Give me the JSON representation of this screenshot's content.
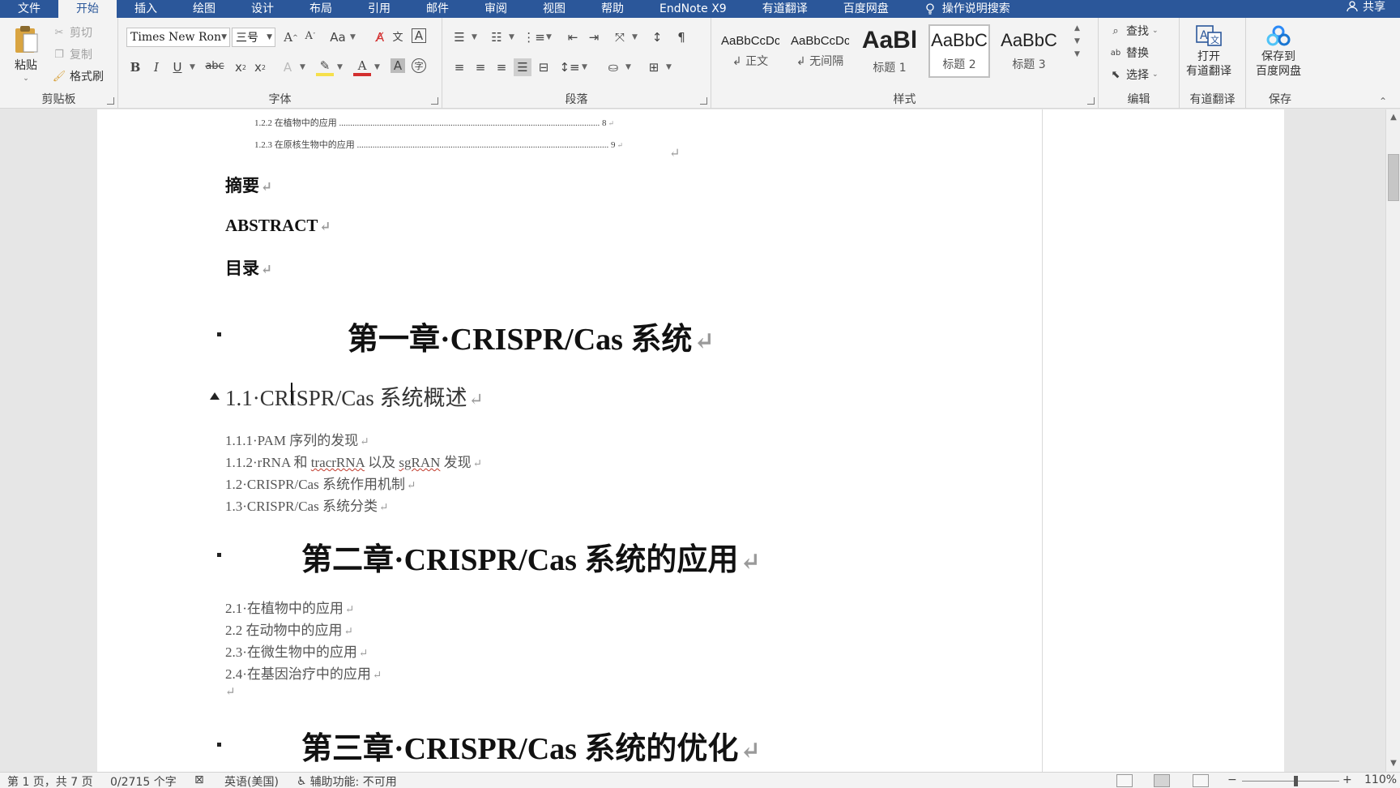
{
  "colors": {
    "ribbon_blue": "#2b579a",
    "accent_red": "#d32f2f",
    "highlight_yellow": "#f6e04b"
  },
  "tabs": [
    {
      "label": "文件",
      "active": false
    },
    {
      "label": "开始",
      "active": true
    },
    {
      "label": "插入",
      "active": false
    },
    {
      "label": "绘图",
      "active": false
    },
    {
      "label": "设计",
      "active": false
    },
    {
      "label": "布局",
      "active": false
    },
    {
      "label": "引用",
      "active": false
    },
    {
      "label": "邮件",
      "active": false
    },
    {
      "label": "审阅",
      "active": false
    },
    {
      "label": "视图",
      "active": false
    },
    {
      "label": "帮助",
      "active": false
    },
    {
      "label": "EndNote X9",
      "active": false
    },
    {
      "label": "有道翻译",
      "active": false
    },
    {
      "label": "百度网盘",
      "active": false
    }
  ],
  "tell_me": "操作说明搜索",
  "share": "共享",
  "clipboard": {
    "label": "剪贴板",
    "paste": "粘贴",
    "cut": "剪切",
    "copy": "复制",
    "format_painter": "格式刷"
  },
  "font": {
    "label": "字体",
    "name": "Times New Ron",
    "size": "三号"
  },
  "paragraph": {
    "label": "段落"
  },
  "styles": {
    "label": "样式",
    "items": [
      {
        "sample": "AaBbCcDc",
        "name": "↲ 正文",
        "selected": false
      },
      {
        "sample": "AaBbCcDc",
        "name": "↲ 无间隔",
        "selected": false
      },
      {
        "sample": "AaBl",
        "name": "标题 1",
        "selected": false
      },
      {
        "sample": "AaBbC",
        "name": "标题 2",
        "selected": true
      },
      {
        "sample": "AaBbC",
        "name": "标题 3",
        "selected": false
      }
    ]
  },
  "editing": {
    "label": "编辑",
    "find": "查找",
    "replace": "替换",
    "select": "选择"
  },
  "youdao": {
    "label": "有道翻译",
    "button": "打开\n有道翻译",
    "line1": "打开",
    "line2": "有道翻译"
  },
  "save": {
    "label": "保存",
    "line1": "保存到",
    "line2": "百度网盘"
  },
  "document": {
    "toc_lines": [
      {
        "text": "1.2.2 在植物中的应用",
        "page": "8"
      },
      {
        "text": "1.2.3 在原核生物中的应用",
        "page": "9"
      }
    ],
    "abstract_cn": "摘要",
    "abstract_en": "ABSTRACT",
    "toc_title": "目录",
    "chapter1": "第一章·CRISPR/Cas 系统",
    "section_1_1": "1.1·CRISPR/Cas 系统概述",
    "sub_1_1_1": "1.1.1·PAM 序列的发现",
    "sub_1_1_2_a": "1.1.2·rRNA 和 ",
    "sub_1_1_2_b": "tracrRNA",
    "sub_1_1_2_c": " 以及 ",
    "sub_1_1_2_d": "sgRAN",
    "sub_1_1_2_e": " 发现",
    "sub_1_2": "1.2·CRISPR/Cas 系统作用机制",
    "sub_1_3": "1.3·CRISPR/Cas 系统分类",
    "chapter2": "第二章·CRISPR/Cas 系统的应用",
    "sub_2_1": "2.1·在植物中的应用",
    "sub_2_2": "2.2 在动物中的应用",
    "sub_2_3": "2.3·在微生物中的应用",
    "sub_2_4": "2.4·在基因治疗中的应用",
    "chapter3": "第三章·CRISPR/Cas 系统的优化"
  },
  "status": {
    "page": "第 1 页，共 7 页",
    "words": "0/2715 个字",
    "language": "英语(美国)",
    "accessibility": "辅助功能: 不可用",
    "zoom": "110%",
    "zoom_fraction": 0.55
  }
}
